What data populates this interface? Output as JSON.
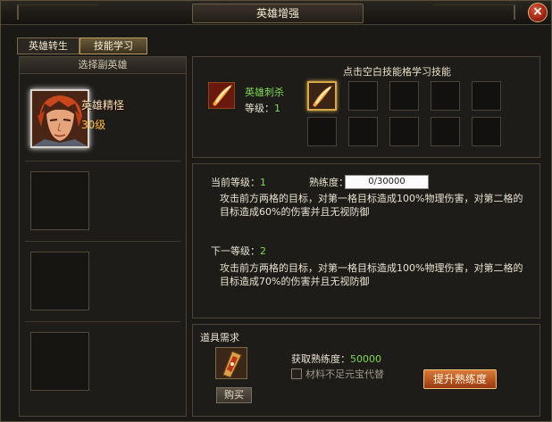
{
  "window": {
    "title": "英雄增强"
  },
  "tabs": [
    {
      "label": "英雄转生"
    },
    {
      "label": "技能学习"
    }
  ],
  "left_panel": {
    "header": "选择副英雄",
    "hero": {
      "name": "英雄精怪",
      "level": "30级"
    }
  },
  "skill_panel": {
    "hint": "点击空白技能格学习技能",
    "skill_name": "英雄刺杀",
    "level_label": "等级：",
    "level_value": "1"
  },
  "info_panel": {
    "current_level_label": "当前等级：",
    "current_level_value": "1",
    "proficiency_label": "熟练度：",
    "proficiency_value": "0/30000",
    "current_desc": "攻击前方两格的目标，对第一格目标造成100%物理伤害，对第二格的目标造成60%的伤害并且无视防御",
    "next_level_label": "下一等级：",
    "next_level_value": "2",
    "next_desc": "攻击前方两格的目标，对第一格目标造成100%物理伤害，对第二格的目标造成70%的伤害并且无视防御"
  },
  "item_panel": {
    "title": "道具需求",
    "buy_label": "购买",
    "gain_label": "获取熟练度：",
    "gain_value": "50000",
    "checkbox_label": "材料不足元宝代替",
    "upgrade_label": "提升熟练度"
  },
  "colors": {
    "accent_green": "#7ed957",
    "gold_border": "#d7a846",
    "upgrade_button": "#c0622a"
  }
}
